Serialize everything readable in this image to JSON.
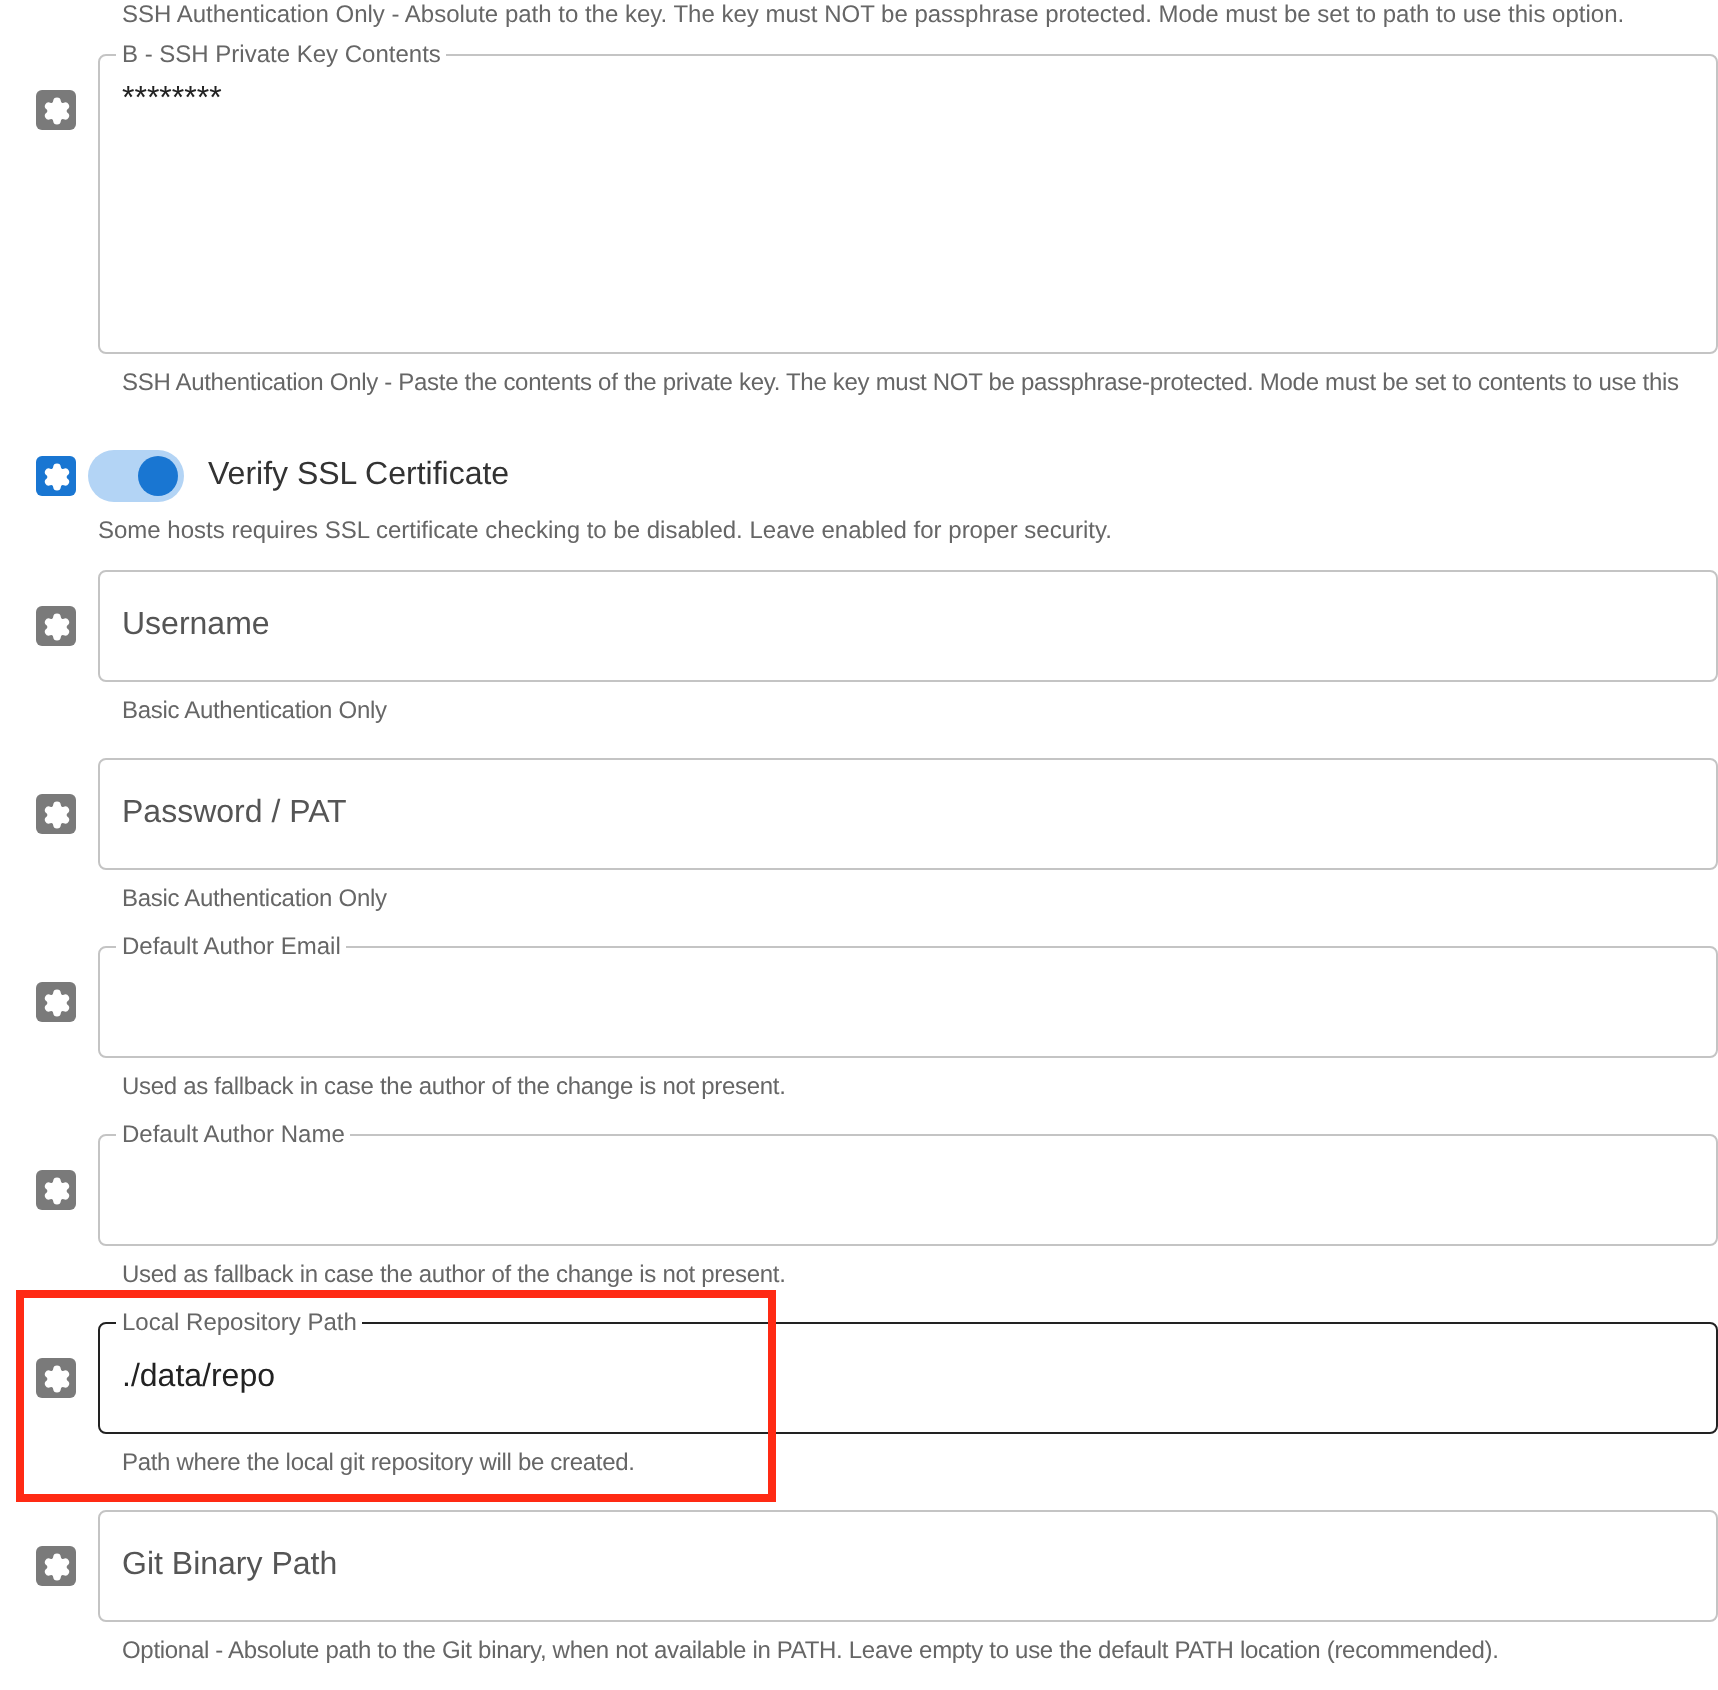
{
  "top_helper": "SSH Authentication Only - Absolute path to the key. The key must NOT be passphrase protected. Mode must be set to path to use this option.",
  "settings": [
    {
      "kind": "textarea",
      "label": "B - SSH Private Key Contents",
      "label_floated": true,
      "value": "********",
      "helper": "SSH Authentication Only - Paste the contents of the private key. The key must NOT be passphrase-protected. Mode must be set to contents to use this",
      "gear_active": false,
      "highlighted": false
    },
    {
      "kind": "toggle",
      "label": "Verify SSL Certificate",
      "checked": true,
      "helper": "Some hosts requires SSL certificate checking to be disabled. Leave enabled for proper security.",
      "gear_active": true
    },
    {
      "kind": "text",
      "label": "Username",
      "label_floated": false,
      "helper": "Basic Authentication Only",
      "gear_active": false,
      "highlighted": false
    },
    {
      "kind": "text",
      "label": "Password / PAT",
      "label_floated": false,
      "helper": "Basic Authentication Only",
      "gear_active": false,
      "highlighted": false
    },
    {
      "kind": "text",
      "label": "Default Author Email",
      "label_floated": true,
      "helper": "Used as fallback in case the author of the change is not present.",
      "gear_active": false,
      "highlighted": false
    },
    {
      "kind": "text",
      "label": "Default Author Name",
      "label_floated": true,
      "helper": "Used as fallback in case the author of the change is not present.",
      "gear_active": false,
      "highlighted": false
    },
    {
      "kind": "text",
      "label": "Local Repository Path",
      "label_floated": true,
      "value": "./data/repo",
      "helper": "Path where the local git repository will be created.",
      "gear_active": false,
      "highlighted": true
    },
    {
      "kind": "text",
      "label": "Git Binary Path",
      "label_floated": false,
      "helper": "Optional - Absolute path to the Git binary, when not available in PATH. Leave empty to use the default PATH location (recommended).",
      "gear_active": false,
      "highlighted": false
    }
  ]
}
